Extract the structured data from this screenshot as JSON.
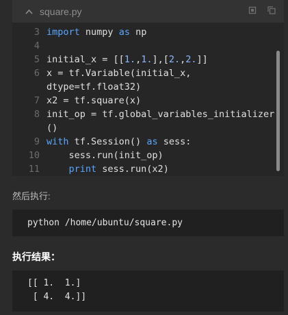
{
  "file": {
    "name": "square.py",
    "icons": [
      "chevron-up-icon",
      "copy-icon",
      "duplicate-icon"
    ]
  },
  "code_lines": [
    {
      "num": "3",
      "tokens": [
        {
          "t": "import",
          "k": "kw"
        },
        {
          "t": " numpy ",
          "k": "plain"
        },
        {
          "t": "as",
          "k": "kw"
        },
        {
          "t": " np",
          "k": "plain"
        }
      ]
    },
    {
      "num": "4",
      "tokens": []
    },
    {
      "num": "5",
      "tokens": [
        {
          "t": "initial_x = [[",
          "k": "plain"
        },
        {
          "t": "1.",
          "k": "num"
        },
        {
          "t": ",",
          "k": "plain"
        },
        {
          "t": "1.",
          "k": "num"
        },
        {
          "t": "],[",
          "k": "plain"
        },
        {
          "t": "2.",
          "k": "num"
        },
        {
          "t": ",",
          "k": "plain"
        },
        {
          "t": "2.",
          "k": "num"
        },
        {
          "t": "]]",
          "k": "plain"
        }
      ]
    },
    {
      "num": "6",
      "tokens": [
        {
          "t": "x = tf.Variable(initial_x,",
          "k": "plain"
        }
      ]
    },
    {
      "num": "",
      "tokens": [
        {
          "t": "dtype=tf.float32)",
          "k": "plain"
        }
      ]
    },
    {
      "num": "7",
      "tokens": [
        {
          "t": "x2 = tf.square(x)",
          "k": "plain"
        }
      ]
    },
    {
      "num": "8",
      "tokens": [
        {
          "t": "init_op = tf.global_variables_initializer",
          "k": "plain"
        }
      ]
    },
    {
      "num": "",
      "tokens": [
        {
          "t": "()",
          "k": "plain"
        }
      ]
    },
    {
      "num": "9",
      "tokens": [
        {
          "t": "with",
          "k": "kw"
        },
        {
          "t": " tf.Session() ",
          "k": "plain"
        },
        {
          "t": "as",
          "k": "kw"
        },
        {
          "t": " sess:",
          "k": "plain"
        }
      ]
    },
    {
      "num": "10",
      "tokens": [
        {
          "t": "    sess.run(init_op)",
          "k": "plain"
        }
      ]
    },
    {
      "num": "11",
      "tokens": [
        {
          "t": "    ",
          "k": "plain"
        },
        {
          "t": "print",
          "k": "kw"
        },
        {
          "t": " sess.run(x2)",
          "k": "plain"
        }
      ]
    }
  ],
  "then_run_label": "然后执行:",
  "command": "python /home/ubuntu/square.py",
  "result_label": "执行结果：",
  "result_lines": [
    "[[ 1.  1.]",
    " [ 4.  4.]]"
  ],
  "colors": {
    "keyword": "#5aa6ff",
    "number": "#8fb8ff",
    "background": "#2b2b2b"
  }
}
